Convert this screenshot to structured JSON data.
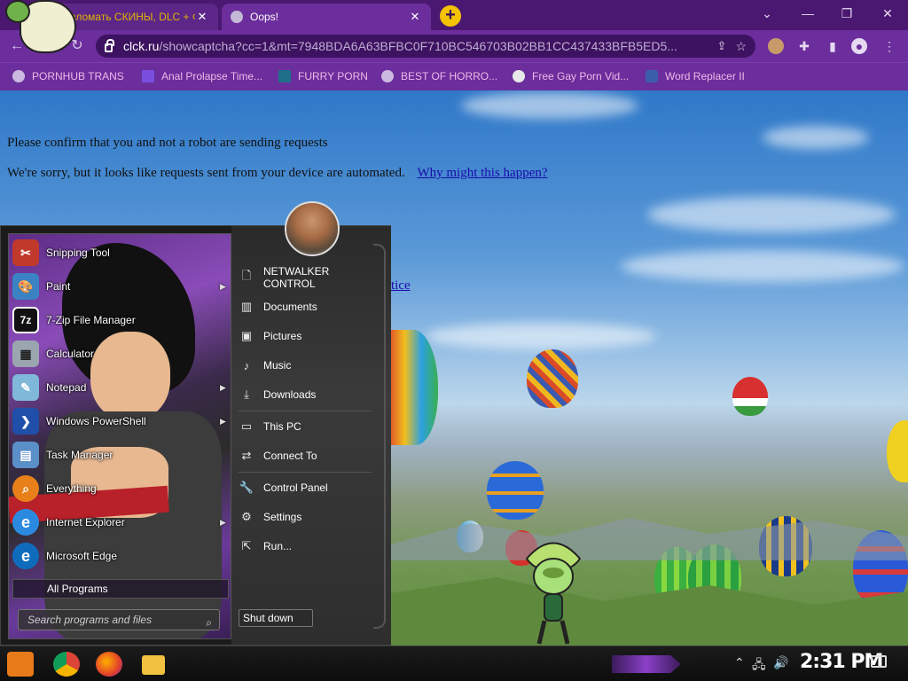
{
  "browser": {
    "tabs": [
      {
        "title": "Взломать СКИНЫ, DLC + Ф",
        "active": false
      },
      {
        "title": "Oops!",
        "active": true
      }
    ],
    "new_tab_label": "+",
    "url_host": "clck.ru",
    "url_rest": "/showcaptcha?cc=1&mt=7948BDA6A63BFBC0F710BC546703B02BB1CC437433BFB5ED5...",
    "bookmarks": [
      {
        "label": "PORNHUB TRANS",
        "icon": "globe-icon"
      },
      {
        "label": "Anal Prolapse Time...",
        "icon": "bracket-icon"
      },
      {
        "label": "FURRY PORN",
        "icon": "lambda-icon"
      },
      {
        "label": "BEST OF HORRO...",
        "icon": "globe-icon"
      },
      {
        "label": "Free Gay Porn Vid...",
        "icon": "skull-icon"
      },
      {
        "label": "Word Replacer II",
        "icon": "wr-icon"
      }
    ]
  },
  "page": {
    "message_1": "Please confirm that you and not a robot are sending requests",
    "message_2": "We're sorry, but it looks like requests sent from your device are automated.",
    "why_link": "Why might this happen?",
    "notice_link": "tice"
  },
  "start_menu": {
    "programs": [
      {
        "label": "Snipping Tool",
        "submenu": false,
        "icon": "scissors-icon",
        "color": "#c0392b"
      },
      {
        "label": "Paint",
        "submenu": true,
        "icon": "palette-icon",
        "color": "#3b82c4"
      },
      {
        "label": "7-Zip File Manager",
        "submenu": false,
        "icon": "7z-icon",
        "color": "#111111"
      },
      {
        "label": "Calculator",
        "submenu": false,
        "icon": "calculator-icon",
        "color": "#9aa5b0"
      },
      {
        "label": "Notepad",
        "submenu": true,
        "icon": "notepad-icon",
        "color": "#7fb8d8"
      },
      {
        "label": "Windows PowerShell",
        "submenu": true,
        "icon": "powershell-icon",
        "color": "#1f4fa8"
      },
      {
        "label": "Task Manager",
        "submenu": false,
        "icon": "task-manager-icon",
        "color": "#5a8fc8"
      },
      {
        "label": "Everything",
        "submenu": false,
        "icon": "magnifier-icon",
        "color": "#e8801a"
      },
      {
        "label": "Internet Explorer",
        "submenu": true,
        "icon": "ie-icon",
        "color": "#2b8ae0"
      },
      {
        "label": "Microsoft Edge",
        "submenu": false,
        "icon": "edge-icon",
        "color": "#0f6cbd"
      }
    ],
    "all_programs": "All Programs",
    "search_placeholder": "Search programs and files",
    "places": [
      {
        "label": "NETWALKER CONTROL",
        "icon": "user-folder-icon"
      },
      {
        "label": "Documents",
        "icon": "library-icon"
      },
      {
        "label": "Pictures",
        "icon": "picture-icon"
      },
      {
        "label": "Music",
        "icon": "music-note-icon"
      },
      {
        "label": "Downloads",
        "icon": "download-icon"
      },
      {
        "label": "This PC",
        "icon": "monitor-icon"
      },
      {
        "label": "Connect To",
        "icon": "connect-icon"
      },
      {
        "label": "Control Panel",
        "icon": "wrench-icon"
      },
      {
        "label": "Settings",
        "icon": "gear-icon"
      },
      {
        "label": "Run...",
        "icon": "run-icon"
      }
    ],
    "shutdown_label": "Shut down"
  },
  "taskbar": {
    "apps": [
      "chrome-icon",
      "firefox-icon",
      "explorer-icon"
    ],
    "clock": "2:31 PM"
  },
  "colors": {
    "browser_frame": "#6b2e9c",
    "tab_strip": "#4a1870",
    "bookmark_text": "#f0b8e8",
    "link": "#1a0dab"
  }
}
